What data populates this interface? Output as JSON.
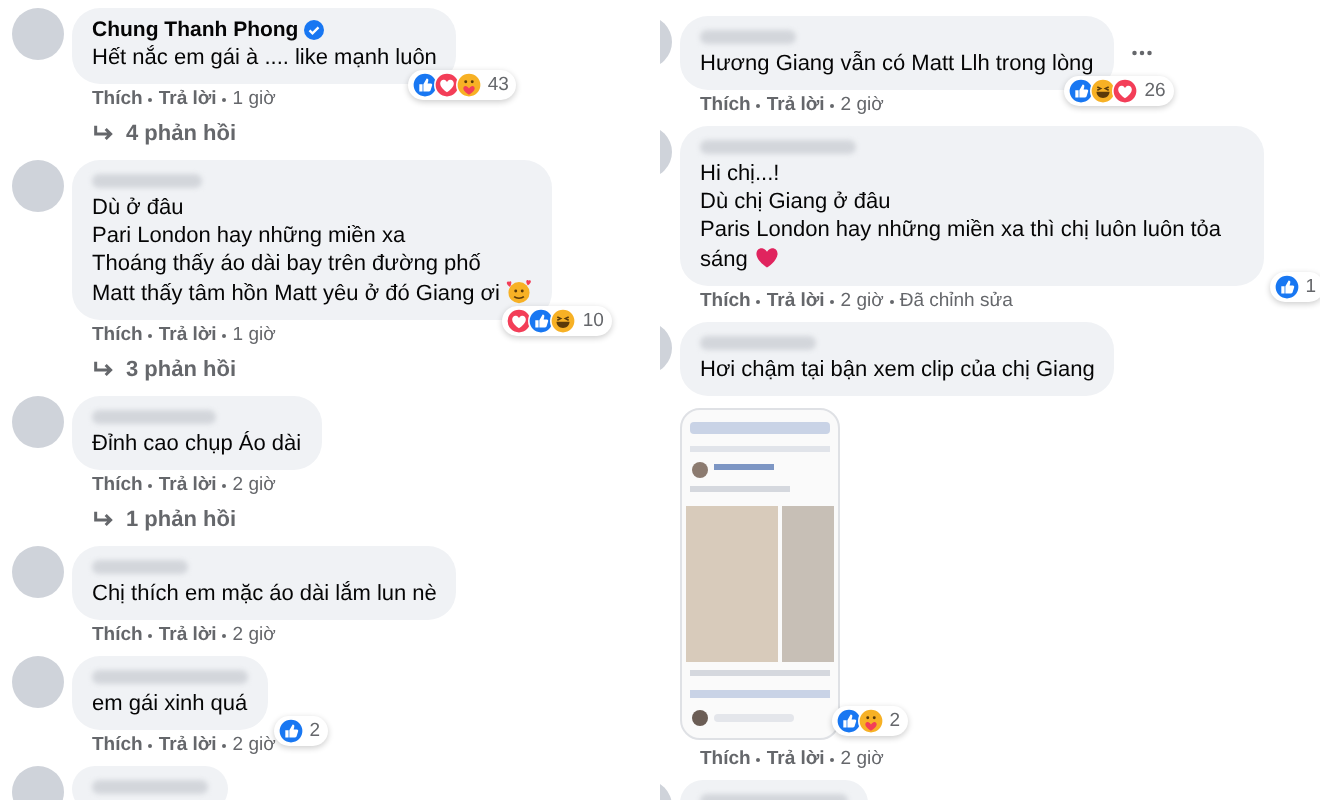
{
  "columns": [
    {
      "comments": [
        {
          "author": "Chung Thanh Phong",
          "verified": true,
          "lines": [
            "Hết nắc em gái à .... like mạnh luôn"
          ],
          "reactions": {
            "icons": [
              {
                "kind": "like"
              },
              {
                "kind": "love"
              },
              {
                "kind": "care"
              }
            ],
            "count": "43"
          },
          "meta": [
            "Thích",
            "Trả lời",
            "1 giờ"
          ],
          "replies": "4 phản hồi"
        },
        {
          "verified": false,
          "lines": [
            "Dù ở đâu",
            "Pari London hay những miền xa",
            "Thoáng thấy áo dài bay trên đường phố",
            "Matt thấy tâm hồn Matt yêu ở đó Giang ơi"
          ],
          "end_emoji": {
            "kind": "hearts-face"
          },
          "reactions": {
            "icons": [
              {
                "kind": "love"
              },
              {
                "kind": "like"
              },
              {
                "kind": "haha"
              }
            ],
            "count": "10"
          },
          "meta": [
            "Thích",
            "Trả lời",
            "1 giờ"
          ],
          "replies": "3 phản hồi"
        },
        {
          "verified": false,
          "lines": [
            "Đỉnh cao chụp Áo dài"
          ],
          "meta": [
            "Thích",
            "Trả lời",
            "2 giờ"
          ],
          "replies": "1 phản hồi"
        },
        {
          "verified": false,
          "lines": [
            "Chị thích em mặc áo dài lắm lun nè"
          ],
          "meta": [
            "Thích",
            "Trả lời",
            "2 giờ"
          ]
        },
        {
          "verified": false,
          "lines": [
            "em gái xinh quá"
          ],
          "reactions": {
            "icons": [
              {
                "kind": "like"
              }
            ],
            "count": "2"
          },
          "meta": [
            "Thích",
            "Trả lời",
            "2 giờ"
          ]
        },
        {
          "verified": false
        }
      ]
    },
    {
      "comments": [
        {
          "verified": false,
          "lines": [
            "Hương Giang vẫn có Matt Llh trong lòng"
          ],
          "more_menu": true,
          "reactions": {
            "icons": [
              {
                "kind": "like"
              },
              {
                "kind": "haha"
              },
              {
                "kind": "love"
              }
            ],
            "count": "26"
          },
          "meta": [
            "Thích",
            "Trả lời",
            "2 giờ"
          ]
        },
        {
          "verified": false,
          "lines": [
            "Hi chị...!",
            "Dù chị Giang ở đâu",
            "Paris London hay những miền xa thì chị luôn luôn tỏa sáng"
          ],
          "end_emoji": {
            "kind": "heart"
          },
          "reactions": {
            "icons": [
              {
                "kind": "like"
              }
            ],
            "count": "1"
          },
          "meta": [
            "Thích",
            "Trả lời",
            "2 giờ",
            "Đã chỉnh sửa"
          ]
        },
        {
          "verified": false,
          "lines": [
            "Hơi chậm tại bận xem clip của chị Giang"
          ],
          "attachment": {
            "kind": "screenshot",
            "reactions": {
              "icons": [
                {
                  "kind": "like"
                },
                {
                  "kind": "care"
                }
              ],
              "count": "2"
            }
          },
          "meta": [
            "Thích",
            "Trả lời",
            "2 giờ"
          ]
        },
        {
          "verified": false
        }
      ]
    }
  ]
}
